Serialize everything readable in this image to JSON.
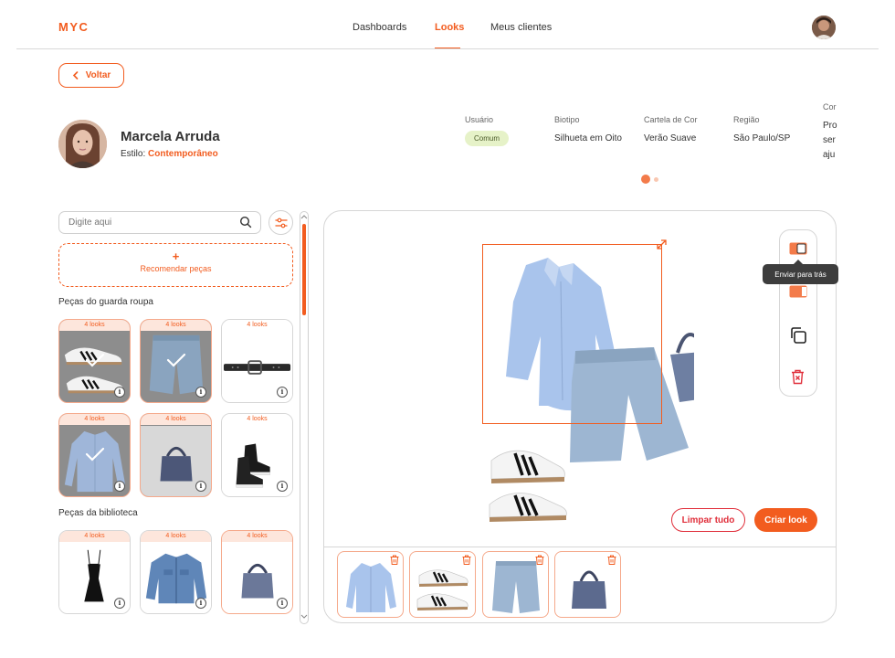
{
  "app": {
    "logo": "MYC"
  },
  "nav": {
    "items": [
      "Dashboards",
      "Looks",
      "Meus clientes"
    ],
    "active": "Looks"
  },
  "back_button": {
    "label": "Voltar"
  },
  "client": {
    "name": "Marcela Arruda",
    "style_label": "Estilo:",
    "style_value": "Contemporâneo",
    "fields": [
      {
        "label": "Usuário",
        "value": "Comum"
      },
      {
        "label": "Biotipo",
        "value": "Silhueta em Oito"
      },
      {
        "label": "Cartela de Cor",
        "value": "Verão Suave"
      },
      {
        "label": "Região",
        "value": "São Paulo/SP"
      },
      {
        "label": "Cor",
        "value": "Pro"
      },
      {
        "label": "",
        "value": "ser"
      },
      {
        "label": "",
        "value": "aju"
      }
    ],
    "pager": {
      "pages": 2,
      "current": 1
    }
  },
  "search": {
    "placeholder": "Digite aqui"
  },
  "recommend": {
    "plus": "+",
    "label": "Recomendar peças"
  },
  "wardrobe": {
    "title": "Peças do guarda roupa",
    "items": [
      {
        "looks": "4 looks",
        "name": "sneakers",
        "selected": true
      },
      {
        "looks": "4 looks",
        "name": "denim-shorts",
        "selected": true
      },
      {
        "looks": "4 looks",
        "name": "belt",
        "selected": false
      },
      {
        "looks": "4 looks",
        "name": "blue-shirt",
        "selected": true
      },
      {
        "looks": "4 looks",
        "name": "tote-bag",
        "selected": false
      },
      {
        "looks": "4 looks",
        "name": "high-top-sneakers",
        "selected": false
      }
    ]
  },
  "library": {
    "title": "Peças da biblioteca",
    "items": [
      {
        "looks": "4 looks",
        "name": "black-dress"
      },
      {
        "looks": "4 looks",
        "name": "denim-jacket"
      },
      {
        "looks": "4 looks",
        "name": "tote-bag"
      }
    ]
  },
  "toolbar": {
    "tooltip": "Enviar para trás"
  },
  "actions": {
    "clear": "Limpar tudo",
    "create": "Criar look"
  },
  "canvas_pieces": [
    "blue-shirt",
    "sneakers",
    "denim-shorts",
    "tote-bag"
  ],
  "colors": {
    "accent": "#F25C1F",
    "danger": "#E02E3A",
    "badge_bg": "#E6F2C8",
    "shirt": "#A9C4EC",
    "denim": "#9DB6D2"
  }
}
